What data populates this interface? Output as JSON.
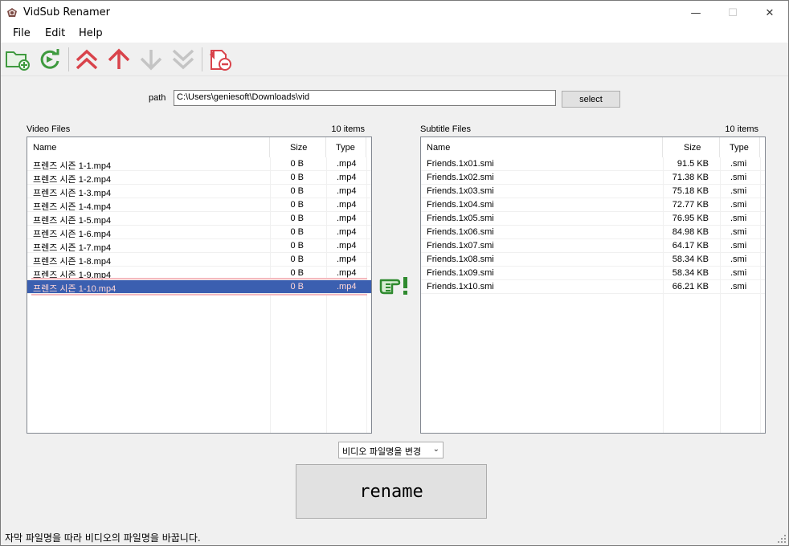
{
  "window": {
    "title": "VidSub Renamer"
  },
  "menu": {
    "file": "File",
    "edit": "Edit",
    "help": "Help"
  },
  "toolbar": {
    "buttons": [
      "open-folder-icon",
      "refresh-icon",
      "move-top-icon",
      "move-up-icon",
      "move-down-icon",
      "move-bottom-icon",
      "remove-item-icon"
    ]
  },
  "path": {
    "label": "path",
    "value": "C:\\Users\\geniesoft\\Downloads\\vid",
    "button": "select"
  },
  "video": {
    "label": "Video Files",
    "count": "10 items",
    "columns": {
      "name": "Name",
      "size": "Size",
      "type": "Type"
    },
    "rows": [
      {
        "name": "프렌즈 시즌 1-1.mp4",
        "size": "0 B",
        "type": ".mp4"
      },
      {
        "name": "프렌즈 시즌 1-2.mp4",
        "size": "0 B",
        "type": ".mp4"
      },
      {
        "name": "프렌즈 시즌 1-3.mp4",
        "size": "0 B",
        "type": ".mp4"
      },
      {
        "name": "프렌즈 시즌 1-4.mp4",
        "size": "0 B",
        "type": ".mp4"
      },
      {
        "name": "프렌즈 시즌 1-5.mp4",
        "size": "0 B",
        "type": ".mp4"
      },
      {
        "name": "프렌즈 시즌 1-6.mp4",
        "size": "0 B",
        "type": ".mp4"
      },
      {
        "name": "프렌즈 시즌 1-7.mp4",
        "size": "0 B",
        "type": ".mp4"
      },
      {
        "name": "프렌즈 시즌 1-8.mp4",
        "size": "0 B",
        "type": ".mp4"
      },
      {
        "name": "프렌즈 시즌 1-9.mp4",
        "size": "0 B",
        "type": ".mp4"
      },
      {
        "name": "프렌즈 시즌 1-10.mp4",
        "size": "0 B",
        "type": ".mp4"
      }
    ]
  },
  "subtitle": {
    "label": "Subtitle Files",
    "count": "10 items",
    "columns": {
      "name": "Name",
      "size": "Size",
      "type": "Type"
    },
    "rows": [
      {
        "name": "Friends.1x01.smi",
        "size": "91.5 KB",
        "type": ".smi"
      },
      {
        "name": "Friends.1x02.smi",
        "size": "71.38 KB",
        "type": ".smi"
      },
      {
        "name": "Friends.1x03.smi",
        "size": "75.18 KB",
        "type": ".smi"
      },
      {
        "name": "Friends.1x04.smi",
        "size": "72.77 KB",
        "type": ".smi"
      },
      {
        "name": "Friends.1x05.smi",
        "size": "76.95 KB",
        "type": ".smi"
      },
      {
        "name": "Friends.1x06.smi",
        "size": "84.98 KB",
        "type": ".smi"
      },
      {
        "name": "Friends.1x07.smi",
        "size": "64.17 KB",
        "type": ".smi"
      },
      {
        "name": "Friends.1x08.smi",
        "size": "58.34 KB",
        "type": ".smi"
      },
      {
        "name": "Friends.1x09.smi",
        "size": "58.34 KB",
        "type": ".smi"
      },
      {
        "name": "Friends.1x10.smi",
        "size": "66.21 KB",
        "type": ".smi"
      }
    ]
  },
  "mode": {
    "selected": "비디오 파일명을 변경"
  },
  "rename": {
    "label": "rename"
  },
  "status": {
    "text": "자막 파일명을 따라 비디오의 파일명을 바꿉니다."
  },
  "colors": {
    "selection": "#3b5fb0",
    "selection_outline": "#f4b9bf",
    "icon_green": "#3f9a3f",
    "icon_red": "#d9434b"
  }
}
